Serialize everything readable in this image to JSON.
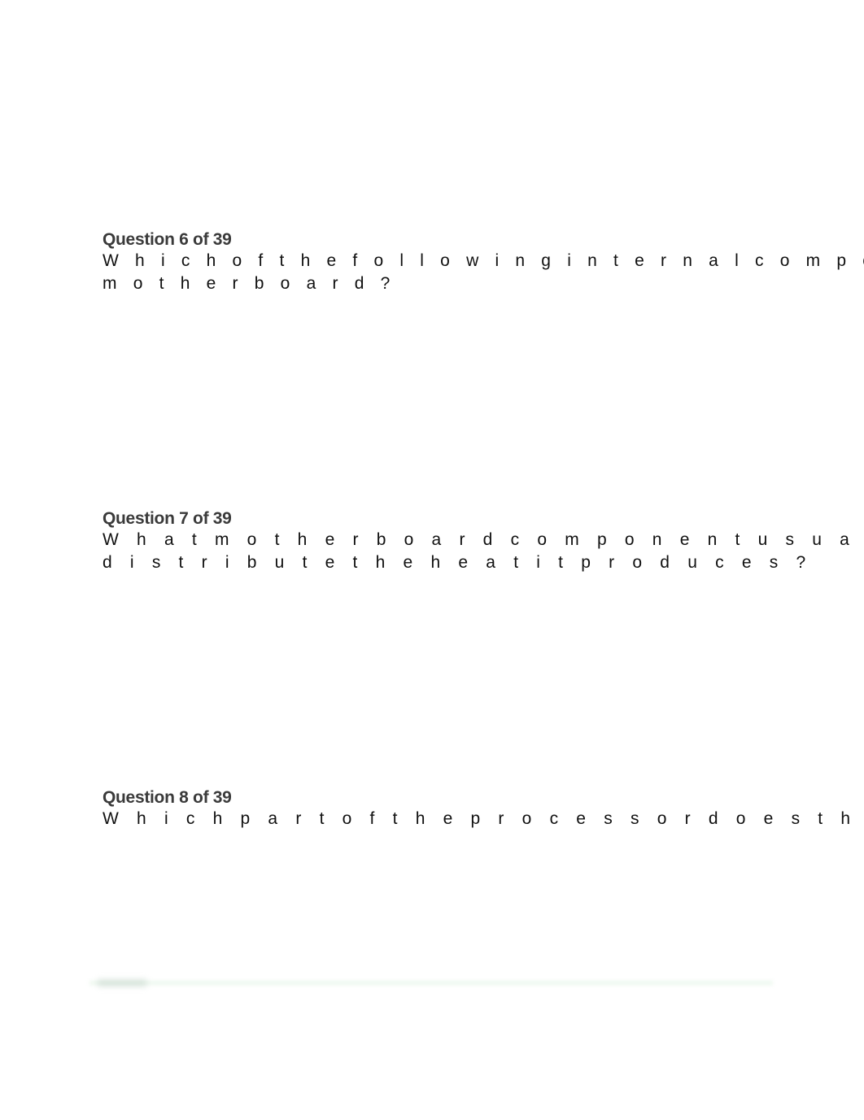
{
  "questions": [
    {
      "title": "Question 6 of 39",
      "line1": "W h i c h   o f   t h e   f o l l o w i n g   i n t e r n a l   c o m p o n e n",
      "line2": "m o t h e r b o a r d ?"
    },
    {
      "title": "Question 7 of 39",
      "line1": "W h a t   m o t h e r b o a r d   c o m p o n e n t   u s u a l l y   h a s   a",
      "line2": "d i s t r i b u t e   t h e   h e a t   i t   p r o d u c e s ?"
    },
    {
      "title": "Question 8 of 39",
      "line1": "W h i c h   p a r t   o f   t h e   p r o c e s s o r   d o e s   t h e   a c t",
      "line2": ""
    }
  ]
}
